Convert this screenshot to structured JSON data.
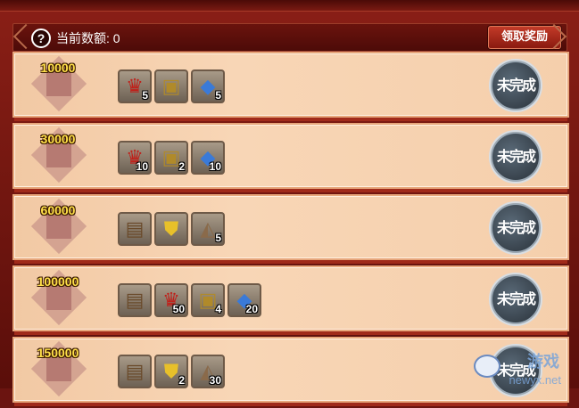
{
  "header": {
    "help_icon": "question-circle-icon",
    "label": "当前数额: 0",
    "claim_button": "领取奖励"
  },
  "status_seal_text": "未完成",
  "rows": [
    {
      "amount": "10000",
      "items": [
        {
          "icon": "gift-bag-icon",
          "glyph": "♛",
          "cls": "g-gift",
          "qty": "5"
        },
        {
          "icon": "treasure-chest-icon",
          "glyph": "▣",
          "cls": "g-chest",
          "qty": ""
        },
        {
          "icon": "blue-gem-icon",
          "glyph": "◆",
          "cls": "g-gem",
          "qty": "5"
        }
      ]
    },
    {
      "amount": "30000",
      "items": [
        {
          "icon": "gift-bag-icon",
          "glyph": "♛",
          "cls": "g-gift",
          "qty": "10"
        },
        {
          "icon": "treasure-chest-icon",
          "glyph": "▣",
          "cls": "g-chest",
          "qty": "2"
        },
        {
          "icon": "blue-gem-icon",
          "glyph": "◆",
          "cls": "g-gem",
          "qty": "10"
        }
      ]
    },
    {
      "amount": "60000",
      "items": [
        {
          "icon": "scroll-book-icon",
          "glyph": "▤",
          "cls": "g-book",
          "qty": ""
        },
        {
          "icon": "shield-icon",
          "glyph": "⛊",
          "cls": "g-shield",
          "qty": ""
        },
        {
          "icon": "ore-rock-icon",
          "glyph": "◭",
          "cls": "g-rock",
          "qty": "5"
        }
      ]
    },
    {
      "amount": "100000",
      "items": [
        {
          "icon": "scroll-book-icon",
          "glyph": "▤",
          "cls": "g-book",
          "qty": ""
        },
        {
          "icon": "gift-bag-icon",
          "glyph": "♛",
          "cls": "g-gift",
          "qty": "50"
        },
        {
          "icon": "treasure-chest-icon",
          "glyph": "▣",
          "cls": "g-chest",
          "qty": "4"
        },
        {
          "icon": "blue-gem-icon",
          "glyph": "◆",
          "cls": "g-gem",
          "qty": "20"
        }
      ]
    },
    {
      "amount": "150000",
      "items": [
        {
          "icon": "scroll-book-icon",
          "glyph": "▤",
          "cls": "g-book",
          "qty": ""
        },
        {
          "icon": "shield-icon",
          "glyph": "⛊",
          "cls": "g-shield",
          "qty": "2"
        },
        {
          "icon": "ore-rock-icon",
          "glyph": "◭",
          "cls": "g-rock",
          "qty": "30"
        }
      ]
    }
  ],
  "watermark": {
    "line1": "游戏",
    "line2": "newyx.net"
  }
}
